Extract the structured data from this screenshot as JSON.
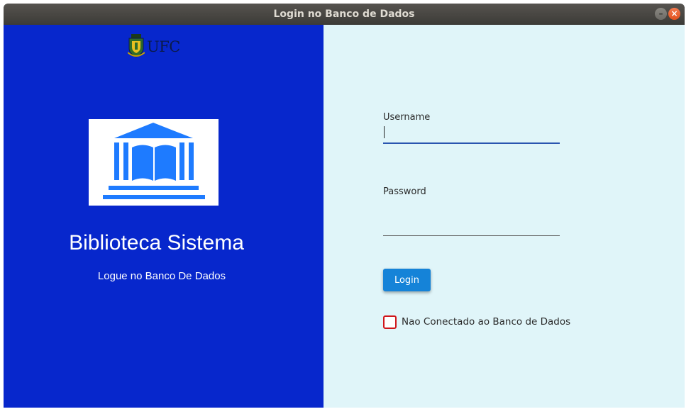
{
  "window": {
    "title": "Login no Banco de Dados",
    "minimize_icon": "minimize-icon",
    "close_icon": "close-icon"
  },
  "branding": {
    "university_logo_text": "UFC",
    "library_icon": "library-building-book-icon",
    "app_title": "Biblioteca Sistema",
    "app_subtitle": "Logue no Banco De Dados"
  },
  "form": {
    "username_label": "Username",
    "username_value": "",
    "password_label": "Password",
    "password_value": "",
    "login_button": "Login",
    "status_checkbox_label": "Nao Conectado ao Banco de Dados",
    "status_checked": false
  },
  "colors": {
    "left_panel": "#0727cc",
    "right_panel": "#e0f5f9",
    "login_button": "#1583d8",
    "checkbox_border": "#d0161b",
    "library_icon": "#1e7bff"
  }
}
